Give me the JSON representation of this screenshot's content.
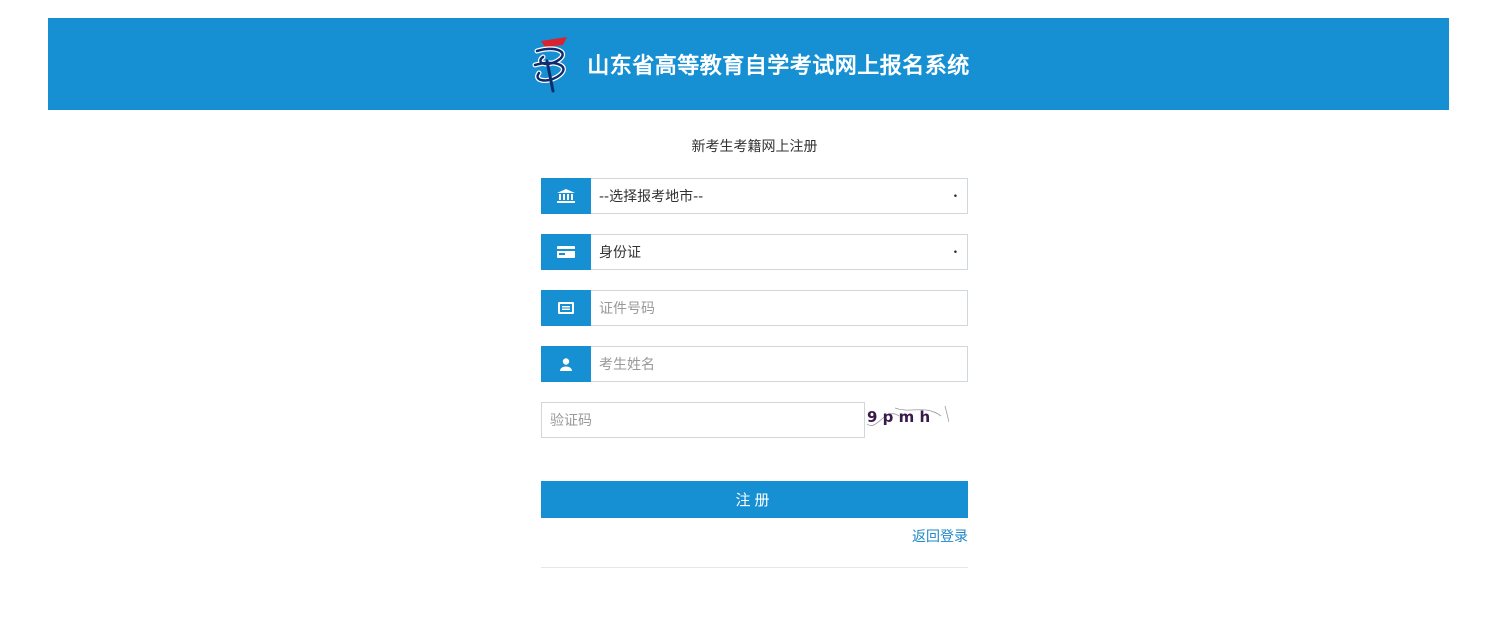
{
  "header": {
    "title": "山东省高等教育自学考试网上报名系统",
    "bg_color": "#1690d3"
  },
  "form": {
    "title": "新考生考籍网上注册",
    "city_select": {
      "value": "--选择报考地市--",
      "icon": "institution-icon"
    },
    "id_type_select": {
      "value": "身份证",
      "icon": "id-card-icon"
    },
    "id_number": {
      "placeholder": "证件号码",
      "icon": "credential-icon"
    },
    "name": {
      "placeholder": "考生姓名",
      "icon": "user-icon"
    },
    "captcha": {
      "placeholder": "验证码",
      "text": "9 p m h"
    },
    "submit_label": "注册",
    "back_login_label": "返回登录"
  }
}
